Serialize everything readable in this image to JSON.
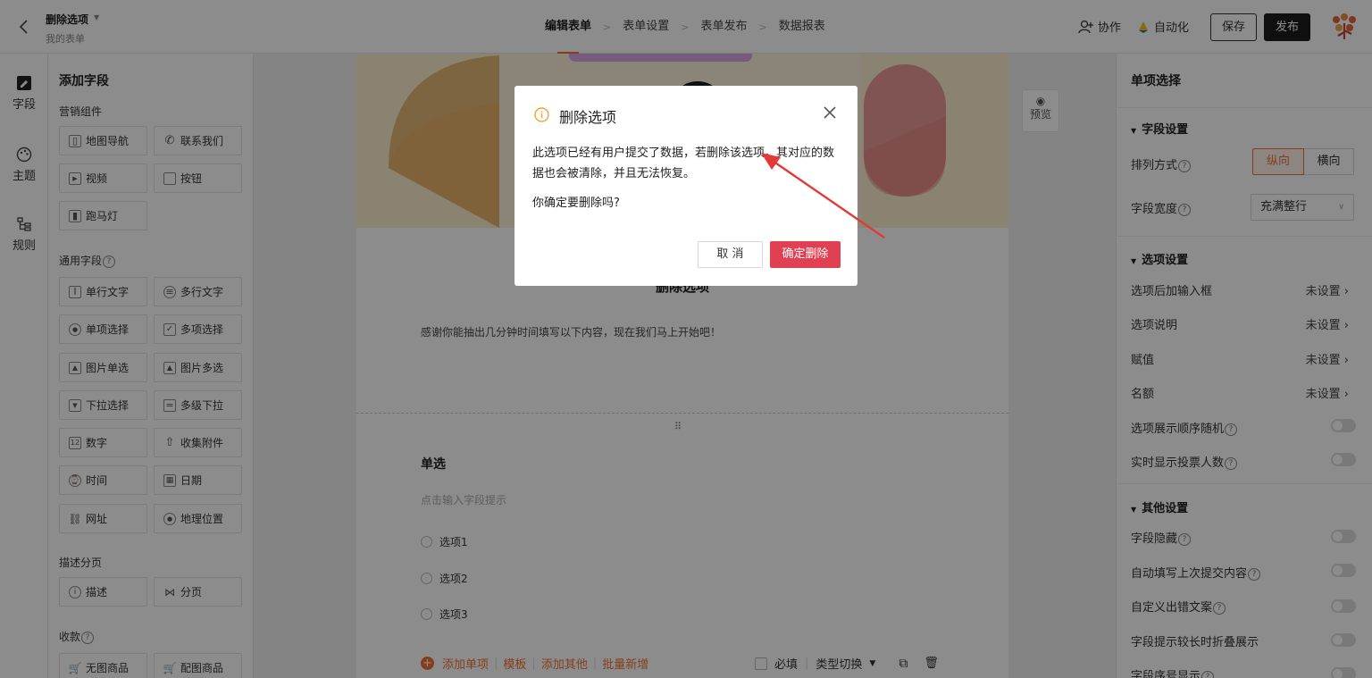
{
  "header": {
    "title": "删除选项",
    "subtitle": "我的表单",
    "steps": [
      "编辑表单",
      "表单设置",
      "表单发布",
      "数据报表"
    ],
    "collab": "协作",
    "automation": "自动化",
    "save": "保存",
    "publish": "发布"
  },
  "leftnav": [
    "字段",
    "主题",
    "规则"
  ],
  "fields": {
    "title": "添加字段",
    "marketing": {
      "label": "营销组件",
      "items": [
        "地图导航",
        "联系我们",
        "视频",
        "按钮",
        "跑马灯"
      ]
    },
    "general": {
      "label": "通用字段",
      "items": [
        "单行文字",
        "多行文字",
        "单项选择",
        "多项选择",
        "图片单选",
        "图片多选",
        "下拉选择",
        "多级下拉",
        "数字",
        "收集附件",
        "时间",
        "日期",
        "网址",
        "地理位置"
      ]
    },
    "desc": {
      "label": "描述分页",
      "items": [
        "描述",
        "分页"
      ]
    },
    "pay": {
      "label": "收款",
      "items": [
        "无图商品",
        "配图商品"
      ]
    }
  },
  "form": {
    "title": "删除选项",
    "intro": "感谢你能抽出几分钟时间填写以下内容，现在我们马上开始吧！",
    "question": "单选",
    "hint": "点击输入字段提示",
    "options": [
      "选项1",
      "选项2",
      "选项3"
    ],
    "actions": [
      "添加单项",
      "模板",
      "添加其他",
      "批量新增"
    ],
    "required": "必填",
    "type_switch": "类型切换"
  },
  "preview": "预览",
  "right": {
    "title": "单项选择",
    "sec1": "字段设置",
    "layout_label": "排列方式",
    "layout_opts": [
      "纵向",
      "横向"
    ],
    "width_label": "字段宽度",
    "width_value": "充满整行",
    "sec2": "选项设置",
    "opt_rows": [
      {
        "label": "选项后加输入框",
        "value": "未设置"
      },
      {
        "label": "选项说明",
        "value": "未设置"
      },
      {
        "label": "赋值",
        "value": "未设置"
      },
      {
        "label": "名额",
        "value": "未设置"
      }
    ],
    "opt_toggles": [
      "选项展示顺序随机",
      "实时显示投票人数"
    ],
    "sec3": "其他设置",
    "other_toggles": [
      "字段隐藏",
      "自动填写上次提交内容",
      "自定义出错文案",
      "字段提示较长时折叠展示",
      "字段序号显示"
    ]
  },
  "modal": {
    "title": "删除选项",
    "body": "此选项已经有用户提交了数据，若删除该选项，其对应的数据也会被清除，并且无法恢复。",
    "question": "你确定要删除吗?",
    "cancel": "取 消",
    "confirm": "确定删除"
  },
  "colors": {
    "accent": "#f27130",
    "danger": "#e04052",
    "dark": "#1c1c1c"
  }
}
